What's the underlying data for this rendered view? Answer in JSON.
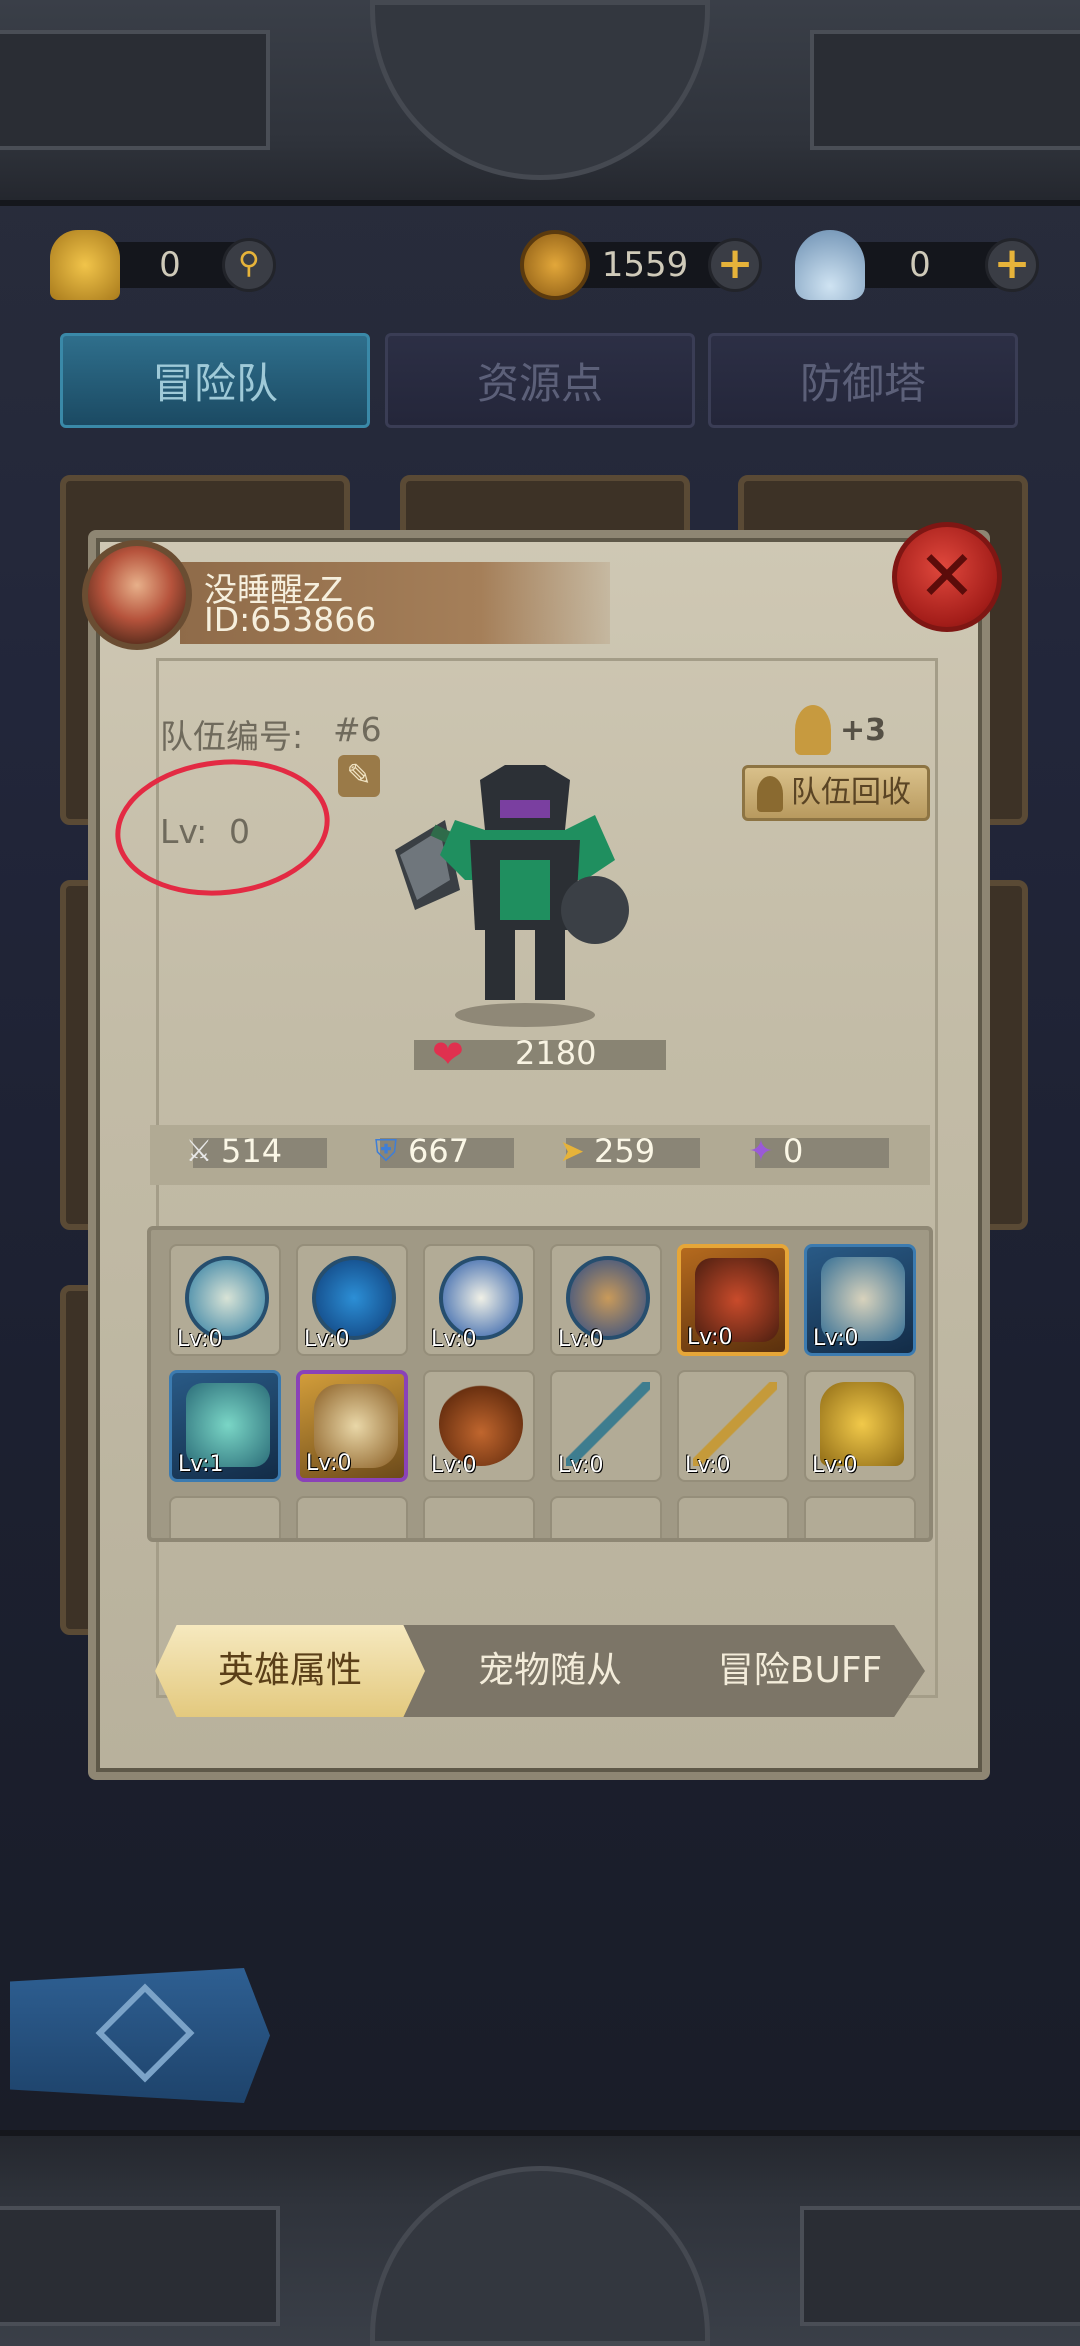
{
  "currencies": {
    "medal": {
      "icon": "medal-icon",
      "value": "0"
    },
    "coin": {
      "icon": "coin-icon",
      "value": "1559"
    },
    "shell": {
      "icon": "shell-icon",
      "value": "0"
    }
  },
  "tabs": [
    "冒险队",
    "资源点",
    "防御塔"
  ],
  "player": {
    "name": "没睡醒zZ",
    "id": "ID:653866"
  },
  "team": {
    "number_label": "队伍编号:",
    "number": "#6",
    "level_label": "Lv:",
    "level": "0",
    "medal_bonus": "+3",
    "recycle_label": "队伍回收"
  },
  "hero": {
    "hp": "2180"
  },
  "stats": [
    {
      "icon": "sword-icon",
      "value": "514"
    },
    {
      "icon": "shield-icon",
      "value": "667"
    },
    {
      "icon": "speed-boot-icon",
      "value": "259"
    },
    {
      "icon": "magic-wand-icon",
      "value": "0"
    }
  ],
  "equipment": [
    {
      "icon": "shell-shield-icon",
      "level": "Lv:0"
    },
    {
      "icon": "turtle-shield-icon",
      "level": "Lv:0"
    },
    {
      "icon": "crystal-shield-icon",
      "level": "Lv:0"
    },
    {
      "icon": "boot-icon",
      "level": "Lv:0"
    },
    {
      "icon": "dragon-icon",
      "level": "Lv:0"
    },
    {
      "icon": "double-shield-icon",
      "level": "Lv:0"
    },
    {
      "icon": "green-shield-icon",
      "level": "Lv:1"
    },
    {
      "icon": "sack-icon",
      "level": "Lv:0"
    },
    {
      "icon": "helmet-icon",
      "level": "Lv:0"
    },
    {
      "icon": "trident-icon",
      "level": "Lv:0"
    },
    {
      "icon": "scepter-icon",
      "level": "Lv:0"
    },
    {
      "icon": "robot-icon",
      "level": "Lv:0"
    }
  ],
  "bottom_tabs": [
    "英雄属性",
    "宠物随从",
    "冒险BUFF"
  ],
  "colors": {
    "accent_red": "#e32a43",
    "gold": "#e6b33a",
    "tab_active": "#2f6f8c"
  }
}
